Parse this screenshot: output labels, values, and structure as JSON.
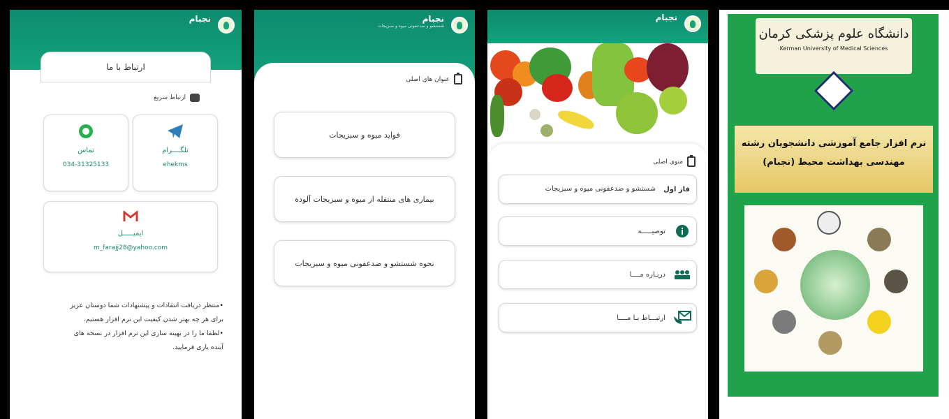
{
  "app": {
    "name": "نجبام"
  },
  "screen1": {
    "title": "ارتباط با ما",
    "quick_link": "ارتباط سریع",
    "telegram": {
      "label": "تلگــــرام",
      "value": "ehekms"
    },
    "phone": {
      "label": "تماس",
      "value": "034-31325133"
    },
    "email": {
      "label": "ایمیـــــل",
      "value": "m_farajj28@yahoo.com"
    },
    "note_line1": "•منتظر دریافت انتقادات و پیشنهادات شما دوستان عزیز",
    "note_line2": "برای هر چه بهتر شدن کیفیت این نرم افزار هستیم.",
    "note_line3": "•لطفا ما را در بهینه سازی این نرم افزار در نسخه های",
    "note_line4": "آینده یاری فرمایید."
  },
  "screen2": {
    "subtitle": "شستشو و ضدعفونی میوه و سبزیجات",
    "section_title": "عنوان های اصلی",
    "items": [
      "فواید میوه و سبزیجات",
      "بیماری های منتقله از میوه و سبزیجات آلوده",
      "نحوه شستشو و ضدعفونی میوه و سبزیجات"
    ]
  },
  "screen3": {
    "section_title": "منوی اصلی",
    "phase_label": "فاز اول",
    "phase_text": "شستشو و ضدعفونی میوه و سبزیجات",
    "items": [
      "توصیـــــه",
      "دربـاره مــــا",
      "ارتبـــاط بـا مــــا"
    ]
  },
  "screen4": {
    "university_fa": "دانشگاه علوم پزشکی کرمان",
    "university_en": "Kerman University of Medical Sciences",
    "title_line1": "نرم افزار جامع آموزشی دانشجویان رشته",
    "title_line2": "مهندسی بهداشت محیط (نجبام)"
  },
  "colors": {
    "brand_green": "#0e8b6e",
    "accent_green": "#1a8a6a",
    "poster_green": "#1fa24a",
    "telegram": "#2c7fb8",
    "whatsapp": "#27b14a",
    "gmail": "#d23b33"
  }
}
